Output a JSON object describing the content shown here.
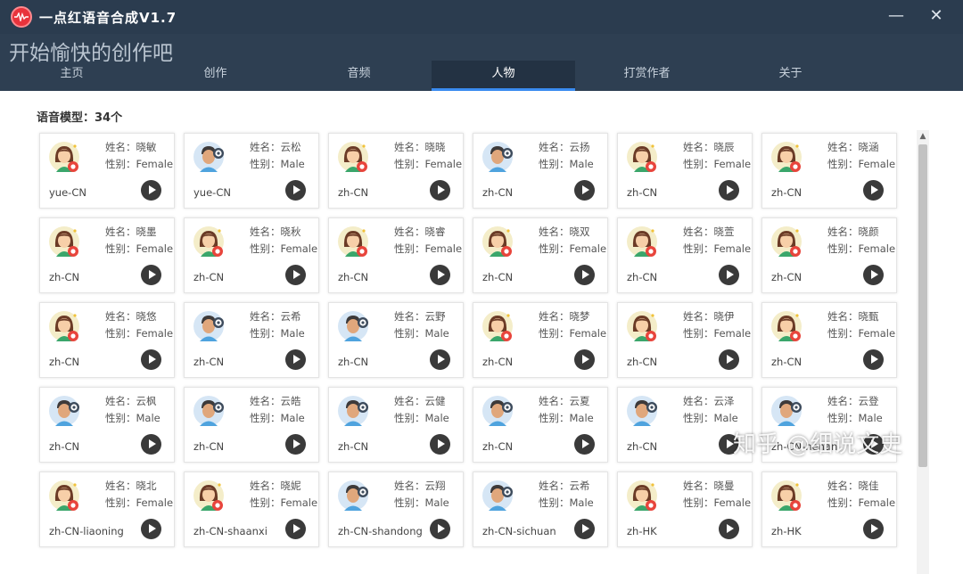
{
  "app": {
    "title": "一点红语音合成V1.7",
    "min_symbol": "—",
    "close_symbol": "✕"
  },
  "header": {
    "slogan": "开始愉快的创作吧"
  },
  "tabs": [
    {
      "label": "主页",
      "active": false
    },
    {
      "label": "创作",
      "active": false
    },
    {
      "label": "音频",
      "active": false
    },
    {
      "label": "人物",
      "active": true
    },
    {
      "label": "打赏作者",
      "active": false
    },
    {
      "label": "关于",
      "active": false
    }
  ],
  "model_count": "语音模型：34个",
  "voices": [
    {
      "name": "姓名：晓敏",
      "gender": "性别：Female",
      "locale": "yue-CN",
      "avatar": "female"
    },
    {
      "name": "姓名：云松",
      "gender": "性别：Male",
      "locale": "yue-CN",
      "avatar": "male"
    },
    {
      "name": "姓名：晓晓",
      "gender": "性别：Female",
      "locale": "zh-CN",
      "avatar": "female"
    },
    {
      "name": "姓名：云扬",
      "gender": "性别：Male",
      "locale": "zh-CN",
      "avatar": "male"
    },
    {
      "name": "姓名：晓辰",
      "gender": "性别：Female",
      "locale": "zh-CN",
      "avatar": "female"
    },
    {
      "name": "姓名：晓涵",
      "gender": "性别：Female",
      "locale": "zh-CN",
      "avatar": "female"
    },
    {
      "name": "姓名：晓墨",
      "gender": "性别：Female",
      "locale": "zh-CN",
      "avatar": "female"
    },
    {
      "name": "姓名：晓秋",
      "gender": "性别：Female",
      "locale": "zh-CN",
      "avatar": "female"
    },
    {
      "name": "姓名：晓睿",
      "gender": "性别：Female",
      "locale": "zh-CN",
      "avatar": "female"
    },
    {
      "name": "姓名：晓双",
      "gender": "性别：Female",
      "locale": "zh-CN",
      "avatar": "female"
    },
    {
      "name": "姓名：晓萱",
      "gender": "性别：Female",
      "locale": "zh-CN",
      "avatar": "female"
    },
    {
      "name": "姓名：晓颜",
      "gender": "性别：Female",
      "locale": "zh-CN",
      "avatar": "female"
    },
    {
      "name": "姓名：晓悠",
      "gender": "性别：Female",
      "locale": "zh-CN",
      "avatar": "female"
    },
    {
      "name": "姓名：云希",
      "gender": "性别：Male",
      "locale": "zh-CN",
      "avatar": "male"
    },
    {
      "name": "姓名：云野",
      "gender": "性别：Male",
      "locale": "zh-CN",
      "avatar": "male"
    },
    {
      "name": "姓名：晓梦",
      "gender": "性别：Female",
      "locale": "zh-CN",
      "avatar": "female"
    },
    {
      "name": "姓名：晓伊",
      "gender": "性别：Female",
      "locale": "zh-CN",
      "avatar": "female"
    },
    {
      "name": "姓名：晓甄",
      "gender": "性别：Female",
      "locale": "zh-CN",
      "avatar": "female"
    },
    {
      "name": "姓名：云枫",
      "gender": "性别：Male",
      "locale": "zh-CN",
      "avatar": "male"
    },
    {
      "name": "姓名：云皓",
      "gender": "性别：Male",
      "locale": "zh-CN",
      "avatar": "male"
    },
    {
      "name": "姓名：云健",
      "gender": "性别：Male",
      "locale": "zh-CN",
      "avatar": "male"
    },
    {
      "name": "姓名：云夏",
      "gender": "性别：Male",
      "locale": "zh-CN",
      "avatar": "male"
    },
    {
      "name": "姓名：云泽",
      "gender": "性别：Male",
      "locale": "zh-CN",
      "avatar": "male"
    },
    {
      "name": "姓名：云登",
      "gender": "性别：Male",
      "locale": "zh-CN-henan",
      "avatar": "male"
    },
    {
      "name": "姓名：晓北",
      "gender": "性别：Female",
      "locale": "zh-CN-liaoning",
      "avatar": "female"
    },
    {
      "name": "姓名：晓妮",
      "gender": "性别：Female",
      "locale": "zh-CN-shaanxi",
      "avatar": "female"
    },
    {
      "name": "姓名：云翔",
      "gender": "性别：Male",
      "locale": "zh-CN-shandong",
      "avatar": "male"
    },
    {
      "name": "姓名：云希",
      "gender": "性别：Male",
      "locale": "zh-CN-sichuan",
      "avatar": "male"
    },
    {
      "name": "姓名：晓曼",
      "gender": "性别：Female",
      "locale": "zh-HK",
      "avatar": "female"
    },
    {
      "name": "姓名：晓佳",
      "gender": "性别：Female",
      "locale": "zh-HK",
      "avatar": "female"
    }
  ],
  "watermark": "知乎 @细说文史",
  "colors": {
    "titlebar": "#2b3c4f",
    "header": "#2e3f52",
    "tab_active_underline": "#3a8bf0",
    "female_badge": "#e8453c",
    "male_badge": "#3d4b5c"
  }
}
